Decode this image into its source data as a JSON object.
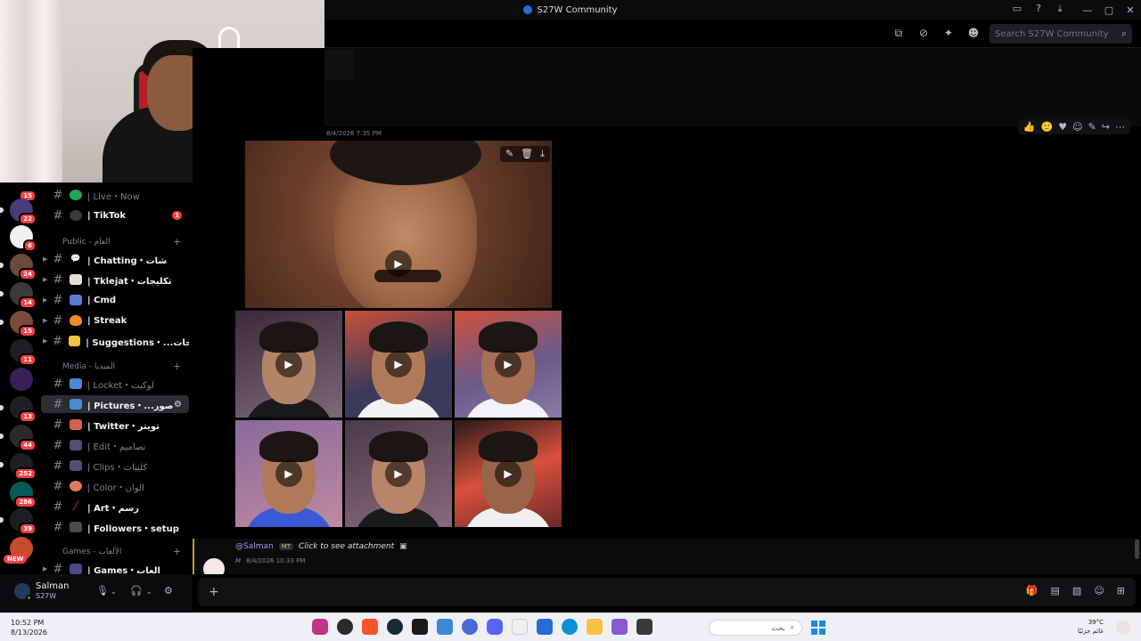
{
  "window": {
    "title": "S27W Community"
  },
  "header": {
    "search_placeholder": "Search S27W Community"
  },
  "servers": [
    {
      "badge": "15",
      "color": "#2a2a2a"
    },
    {
      "badge": "22",
      "color": "#4a3a7a"
    },
    {
      "badge": "6",
      "color": "#f0f0f0"
    },
    {
      "badge": "24",
      "color": "#6a4a3a"
    },
    {
      "badge": "14",
      "color": "#3a3a3a"
    },
    {
      "badge": "15",
      "color": "#7a4a3a"
    },
    {
      "badge": "11",
      "color": "#1e1f22"
    },
    {
      "badge": "",
      "color": "#3b1f5a"
    },
    {
      "badge": "13",
      "color": "#1e1f22"
    },
    {
      "badge": "44",
      "color": "#2a2a2a"
    },
    {
      "badge": "252",
      "color": "#1e1f22"
    },
    {
      "badge": "286",
      "color": "#0a5a5a"
    },
    {
      "badge": "39",
      "color": "#1e1f22"
    },
    {
      "badge": "",
      "color": "#c84a2a"
    }
  ],
  "new_label": "NEW",
  "channels": {
    "live": "| Live・Now",
    "tiktok": "| TikTok",
    "tiktok_badge": "1",
    "cat_public": "Public - العام",
    "chatting": "| Chatting・شات",
    "tklejat": "| Tklejat・تكليجات",
    "cmd": "| Cmd",
    "streak": "| Streak",
    "suggestions": "| Suggestions・...احات",
    "cat_media": "Media - الميديا",
    "locket": "| Locket・لوكيت",
    "pictures": "| Pictures・...صور",
    "twitter": "| Twitter・تويتر",
    "edit": "| Edit・تصاميم",
    "clips": "| Clips・كليبات",
    "color": "| Color・الوان",
    "art": "| Art・رسم",
    "followers": "| Followers・setup",
    "cat_games": "Games - الألعاب",
    "games": "| Games・العاب"
  },
  "user": {
    "name": "Salman",
    "tag": "S27W"
  },
  "message": {
    "timestamp": "8/4/2026 7:35 PM",
    "reply_mention": "@Salman",
    "reply_tag": "MT",
    "reply_text": "Click to see attachment",
    "meta_time": "8/4/2026 10:33 PM"
  },
  "taskbar": {
    "time": "10:52 PM",
    "date": "8/13/2026",
    "search": "بحث",
    "temp": "39°C",
    "weather": "غائم جزئيًا"
  }
}
